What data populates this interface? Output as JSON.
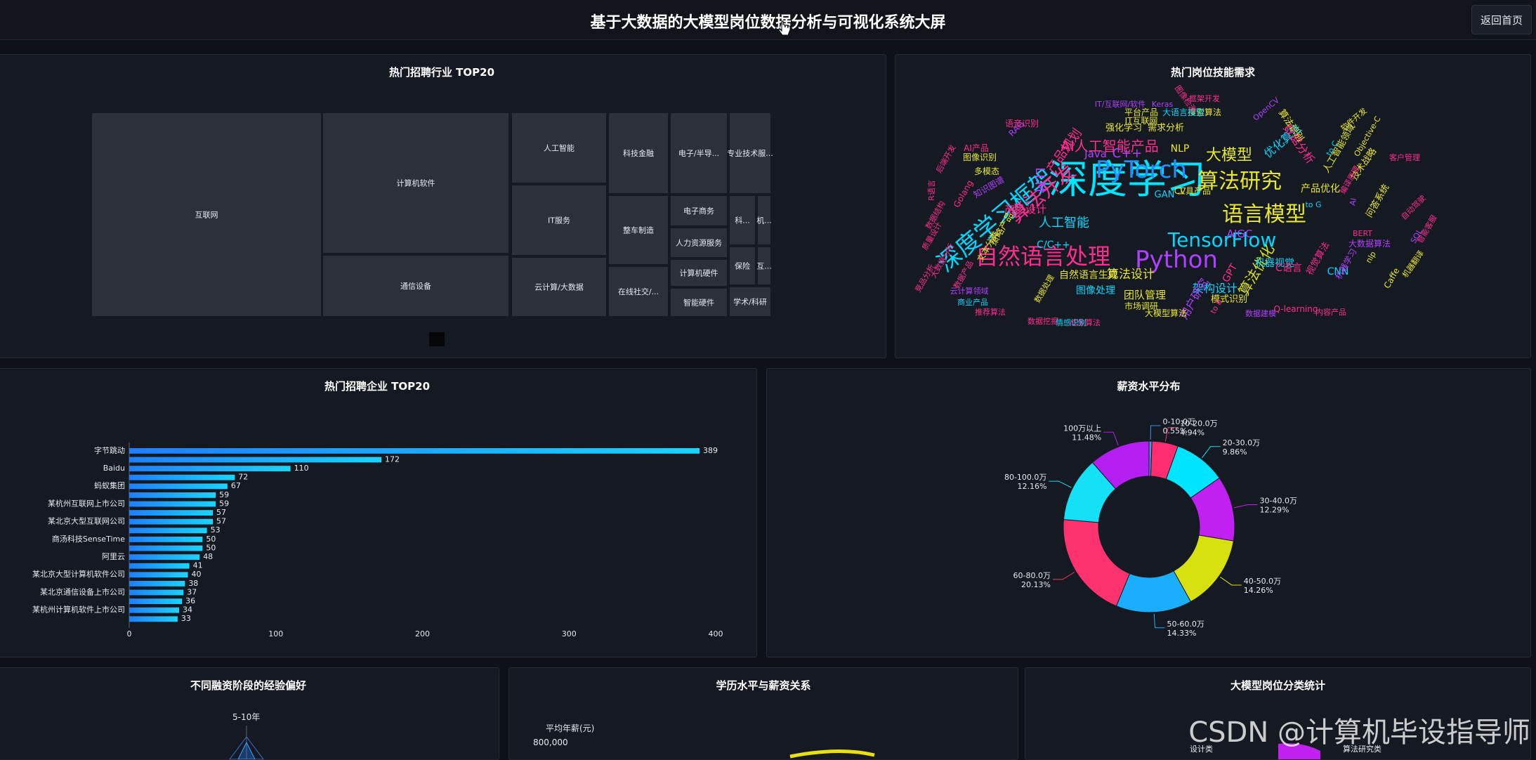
{
  "header": {
    "title": "基于大数据的大模型岗位数据分析与可视化系统大屏",
    "back_label": "返回首页"
  },
  "panels": {
    "industry": "热门招聘行业 TOP20",
    "skills": "热门岗位技能需求",
    "companies": "热门招聘企业 TOP20",
    "salary": "薪资水平分布",
    "funding": "不同融资阶段的经验偏好",
    "education": "学历水平与薪资关系",
    "category": "大模型岗位分类统计"
  },
  "treemap": [
    {
      "label": "互联网"
    },
    {
      "label": "计算机软件"
    },
    {
      "label": "通信设备"
    },
    {
      "label": "人工智能"
    },
    {
      "label": "IT服务"
    },
    {
      "label": "云计算/大数据"
    },
    {
      "label": "科技金融"
    },
    {
      "label": "电子/半导..."
    },
    {
      "label": "专业技术服..."
    },
    {
      "label": "整车制造"
    },
    {
      "label": "在线社交/..."
    },
    {
      "label": "电子商务"
    },
    {
      "label": "人力资源服务"
    },
    {
      "label": "计算机硬件"
    },
    {
      "label": "智能硬件"
    },
    {
      "label": "科..."
    },
    {
      "label": "机..."
    },
    {
      "label": "保险"
    },
    {
      "label": "互..."
    },
    {
      "label": "学术/科研"
    }
  ],
  "chart_data": [
    {
      "type": "bar",
      "title": "热门招聘企业 TOP20",
      "categories": [
        "字节跳动",
        "",
        "Baidu",
        "",
        "蚂蚁集团",
        "",
        "某杭州互联网上市公司",
        "",
        "某北京大型互联网公司",
        "",
        "商汤科技SenseTime",
        "",
        "阿里云",
        "",
        "某北京大型计算机软件公司",
        "",
        "某北京通信设备上市公司",
        "",
        "某杭州计算机软件上市公司",
        ""
      ],
      "values": [
        389,
        172,
        110,
        72,
        67,
        59,
        59,
        57,
        57,
        53,
        50,
        50,
        48,
        41,
        40,
        38,
        37,
        36,
        34,
        33
      ],
      "xlim": [
        0,
        400
      ],
      "xticks": [
        0,
        100,
        200,
        300,
        400
      ]
    },
    {
      "type": "pie",
      "title": "薪资水平分布",
      "slices": [
        {
          "label": "0-10.0万",
          "pct": "0.55%",
          "value": 0.55,
          "color": "#4a90e2"
        },
        {
          "label": "10-20.0万",
          "pct": "4.94%",
          "value": 4.94,
          "color": "#ff2d6f"
        },
        {
          "label": "20-30.0万",
          "pct": "9.86%",
          "value": 9.86,
          "color": "#00e5ff"
        },
        {
          "label": "30-40.0万",
          "pct": "12.29%",
          "value": 12.29,
          "color": "#c020f0"
        },
        {
          "label": "40-50.0万",
          "pct": "14.26%",
          "value": 14.26,
          "color": "#d8e010"
        },
        {
          "label": "50-60.0万",
          "pct": "14.33%",
          "value": 14.33,
          "color": "#1aaefc"
        },
        {
          "label": "60-80.0万",
          "pct": "20.13%",
          "value": 20.13,
          "color": "#ff3270"
        },
        {
          "label": "80-100.0万",
          "pct": "12.16%",
          "value": 12.16,
          "color": "#14e0f6"
        },
        {
          "label": "100万以上",
          "pct": "11.48%",
          "value": 11.48,
          "color": "#b51ef0"
        }
      ]
    }
  ],
  "wordcloud": [
    {
      "t": "深度学习",
      "c": "#00e5ff"
    },
    {
      "t": "深度学习框架",
      "c": "#00d8ff"
    },
    {
      "t": "PyTorch",
      "c": "#1e90ff"
    },
    {
      "t": "算法研究",
      "c": "#e8e82a"
    },
    {
      "t": "语言模型",
      "c": "#e8e82a"
    },
    {
      "t": "自然语言处理",
      "c": "#ff2d8f"
    },
    {
      "t": "Python",
      "c": "#b040ff"
    },
    {
      "t": "TensorFlow",
      "c": "#00d8ff"
    },
    {
      "t": "算法开发",
      "c": "#ff2d8f"
    },
    {
      "t": "AI人工智能产品",
      "c": "#ff2d8f"
    },
    {
      "t": "大模型",
      "c": "#e8e82a"
    },
    {
      "t": "C++",
      "c": "#b040ff"
    },
    {
      "t": "算法优化",
      "c": "#d8e010"
    },
    {
      "t": "人工智能",
      "c": "#00d8ff"
    },
    {
      "t": "产品规划",
      "c": "#ff2d8f"
    },
    {
      "t": "优化算法",
      "c": "#00d8ff"
    },
    {
      "t": "产品设计",
      "c": "#ff2d8f"
    },
    {
      "t": "Java",
      "c": "#b040ff"
    },
    {
      "t": "算法设计",
      "c": "#e8e82a"
    },
    {
      "t": "架构设计",
      "c": "#00d8ff"
    },
    {
      "t": "C/C++",
      "c": "#00d8ff"
    },
    {
      "t": "用户研究",
      "c": "#b040ff"
    },
    {
      "t": "团队管理",
      "c": "#e8e82a"
    },
    {
      "t": "自然语言生成",
      "c": "#e8e82a"
    },
    {
      "t": "LLM",
      "c": "#b040ff"
    },
    {
      "t": "NLP",
      "c": "#e8e82a"
    },
    {
      "t": "强化学习",
      "c": "#e8e82a"
    },
    {
      "t": "需求分析",
      "c": "#e8e82a"
    },
    {
      "t": "机器视觉",
      "c": "#00d8ff"
    },
    {
      "t": "C语言",
      "c": "#ff2d8f"
    },
    {
      "t": "AIGC",
      "c": "#b040ff"
    },
    {
      "t": "图像处理",
      "c": "#00d8ff"
    },
    {
      "t": "模式识别",
      "c": "#e8e82a"
    },
    {
      "t": "产品优化",
      "c": "#e8e82a"
    },
    {
      "t": "GAN",
      "c": "#00d8ff"
    },
    {
      "t": "CV",
      "c": "#e8e82a"
    },
    {
      "t": "工具产品",
      "c": "#e8e82a"
    },
    {
      "t": "策略产品",
      "c": "#e8e82a"
    },
    {
      "t": "文本分类",
      "c": "#e8e82a"
    },
    {
      "t": "Golang",
      "c": "#ff2d8f"
    },
    {
      "t": "多模态",
      "c": "#e8e82a"
    },
    {
      "t": "知识图谱",
      "c": "#b040ff"
    },
    {
      "t": "CNN",
      "c": "#00d8ff"
    },
    {
      "t": "GPT",
      "c": "#ff2d8f"
    },
    {
      "t": "RAG",
      "c": "#b040ff"
    },
    {
      "t": "Q-learning",
      "c": "#ff2d8f"
    },
    {
      "t": "内容产品",
      "c": "#ff2d8f"
    },
    {
      "t": "大模型算法",
      "c": "#e8e82a"
    },
    {
      "t": "市场调研",
      "c": "#e8e82a"
    },
    {
      "t": "搜索算法",
      "c": "#e8e82a"
    },
    {
      "t": "平台产品",
      "c": "#e8e82a"
    },
    {
      "t": "大语言模型",
      "c": "#00d8ff"
    },
    {
      "t": "IT互联网",
      "c": "#e8e82a"
    },
    {
      "t": "语音识别",
      "c": "#ff2d8f"
    },
    {
      "t": "AI产品",
      "c": "#ff2d8f"
    },
    {
      "t": "图像识别",
      "c": "#e8e82a"
    },
    {
      "t": "数据分析",
      "c": "#ff2d8f"
    },
    {
      "t": "算法识别",
      "c": "#e8e82a"
    },
    {
      "t": "人工智能领域",
      "c": "#e8e82a"
    },
    {
      "t": "技术战略",
      "c": "#e8e82a"
    },
    {
      "t": "软件开发",
      "c": "#e8e82a"
    },
    {
      "t": "问答系统",
      "c": "#e8e82a"
    },
    {
      "t": "视觉算法",
      "c": "#ff2d8f"
    },
    {
      "t": "大数据算法",
      "c": "#b040ff"
    },
    {
      "t": "机器学习",
      "c": "#b040ff"
    },
    {
      "t": "Caffe",
      "c": "#e8e82a"
    },
    {
      "t": "商业产品",
      "c": "#00d8ff"
    },
    {
      "t": "推荐算法",
      "c": "#ff2d8f"
    },
    {
      "t": "数据挖掘",
      "c": "#ff2d8f"
    },
    {
      "t": "成像算法",
      "c": "#ff2d8f"
    },
    {
      "t": "情感识别",
      "c": "#00d8ff"
    },
    {
      "t": "云计算领域",
      "c": "#b040ff"
    },
    {
      "t": "数据产品",
      "c": "#ff2d8f"
    },
    {
      "t": "IT/互联网/软件",
      "c": "#b040ff"
    },
    {
      "t": "Keras",
      "c": "#b040ff"
    },
    {
      "t": "BERT",
      "c": "#ff2d8f"
    },
    {
      "t": "SQL",
      "c": "#b040ff"
    },
    {
      "t": "OpenCV",
      "c": "#b040ff"
    },
    {
      "t": "to G",
      "c": "#00d8ff"
    },
    {
      "t": "to C",
      "c": "#00d8ff"
    },
    {
      "t": "to B",
      "c": "#ff2d8f"
    },
    {
      "t": "nlp",
      "c": "#e8e82a"
    },
    {
      "t": "AI",
      "c": "#b040ff"
    },
    {
      "t": "R语言",
      "c": "#ff2d8f"
    },
    {
      "t": "框架开发",
      "c": "#ff2d8f"
    },
    {
      "t": "客户管理",
      "c": "#ff2d8f"
    },
    {
      "t": "自动驾驶",
      "c": "#ff2d8f"
    },
    {
      "t": "机器翻译",
      "c": "#e8e82a"
    },
    {
      "t": "智能客服",
      "c": "#ff2d8f"
    },
    {
      "t": "图像检测",
      "c": "#ff2d8f"
    },
    {
      "t": "Objective-C",
      "c": "#e8e82a"
    },
    {
      "t": "数据建模",
      "c": "#b040ff"
    },
    {
      "t": "后端开发",
      "c": "#ff2d8f"
    },
    {
      "t": "数据结构",
      "c": "#ff2d8f"
    },
    {
      "t": "质量设计",
      "c": "#ff2d8f"
    },
    {
      "t": "大数据分析",
      "c": "#ff2d8f"
    },
    {
      "t": "数据处理",
      "c": "#e8e82a"
    },
    {
      "t": "竞品分析",
      "c": "#ff2d8f"
    },
    {
      "t": "编译原理",
      "c": "#ff2d8f"
    }
  ],
  "radar": {
    "label": "5-10年"
  },
  "education": {
    "axis_name": "平均年薪(元)",
    "tick": "800,000"
  },
  "category_labels": [
    "设计类",
    "算法研究类"
  ],
  "watermark": "CSDN @计算机毕设指导师"
}
